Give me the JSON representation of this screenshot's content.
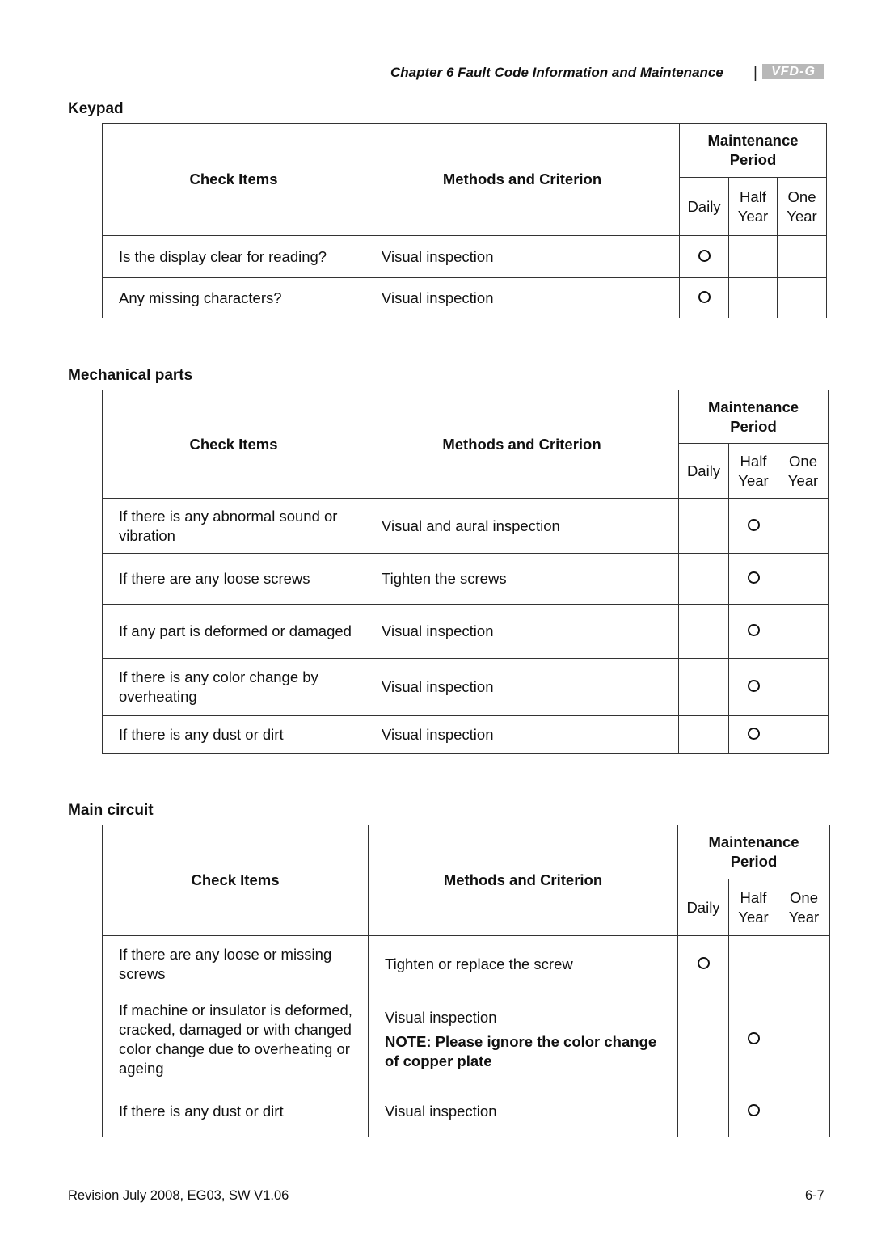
{
  "header": {
    "chapter": "Chapter 6  Fault Code Information and Maintenance",
    "separator": "|",
    "logo": "VFD-G"
  },
  "columns": {
    "check_items": "Check Items",
    "methods": "Methods and Criterion",
    "period_line1": "Maintenance",
    "period_line2": "Period",
    "daily": "Daily",
    "half_line1": "Half",
    "half_line2": "Year",
    "one_line1": "One",
    "one_line2": "Year"
  },
  "mark_symbol": "circle",
  "sections": [
    {
      "title": "Keypad",
      "rows": [
        {
          "item": "Is the display clear for reading?",
          "method": "Visual inspection",
          "note": "",
          "period": "daily"
        },
        {
          "item": "Any missing characters?",
          "method": "Visual inspection",
          "note": "",
          "period": "daily"
        }
      ]
    },
    {
      "title": "Mechanical parts",
      "rows": [
        {
          "item": "If there is any abnormal sound or vibration",
          "method": "Visual and aural inspection",
          "note": "",
          "period": "half_year"
        },
        {
          "item": "If there are any loose screws",
          "method": "Tighten the screws",
          "note": "",
          "period": "half_year"
        },
        {
          "item": "If any part is deformed or damaged",
          "method": "Visual inspection",
          "note": "",
          "period": "half_year"
        },
        {
          "item": "If there is any color change by overheating",
          "method": "Visual inspection",
          "note": "",
          "period": "half_year"
        },
        {
          "item": "If there is any dust or dirt",
          "method": "Visual inspection",
          "note": "",
          "period": "half_year"
        }
      ]
    },
    {
      "title": "Main circuit",
      "rows": [
        {
          "item": "If there are any loose or missing screws",
          "method": "Tighten or replace the screw",
          "note": "",
          "period": "daily"
        },
        {
          "item": "If machine or insulator is deformed, cracked, damaged or with changed color change due to overheating or ageing",
          "method": "Visual inspection",
          "note": "NOTE: Please ignore the color change of copper plate",
          "period": "half_year"
        },
        {
          "item": "If there is any dust or dirt",
          "method": "Visual inspection",
          "note": "",
          "period": "half_year"
        }
      ]
    }
  ],
  "footer": {
    "revision": "Revision July 2008, EG03, SW V1.06",
    "page": "6-7"
  }
}
